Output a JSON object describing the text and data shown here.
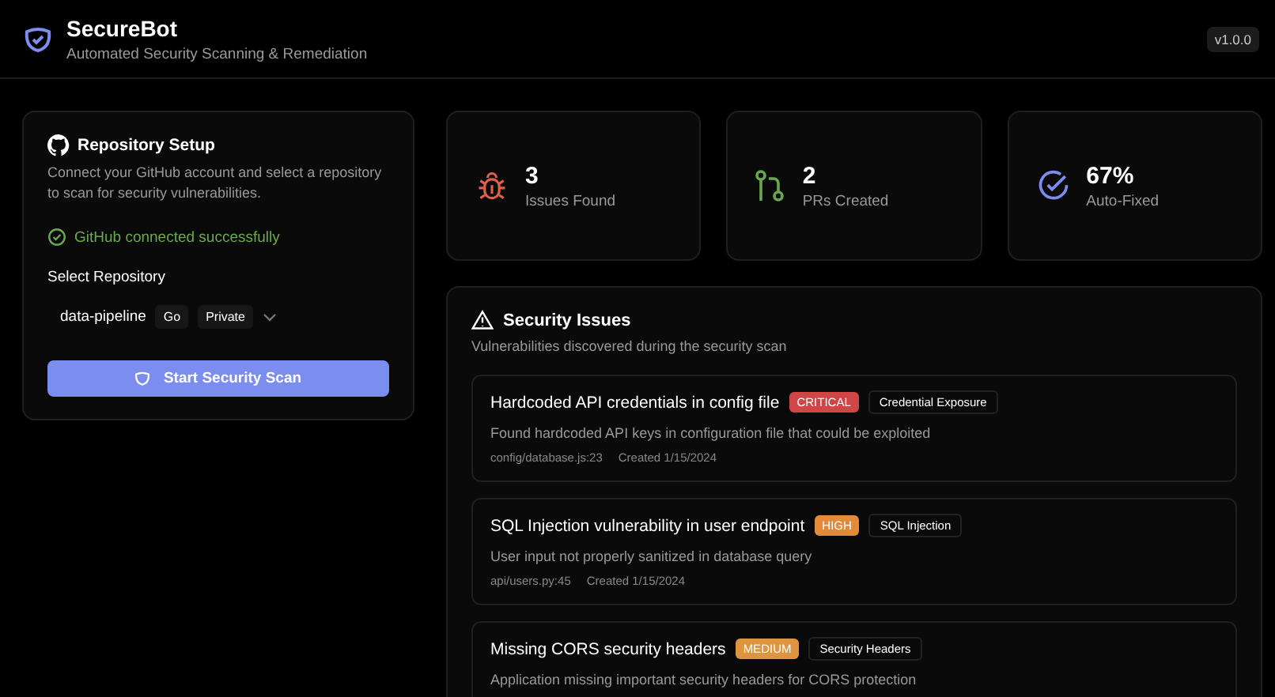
{
  "header": {
    "title": "SecureBot",
    "subtitle": "Automated Security Scanning & Remediation",
    "version": "v1.0.0"
  },
  "setup": {
    "title": "Repository Setup",
    "description": "Connect your GitHub account and select a repository to scan for security vulnerabilities.",
    "status": "GitHub connected successfully",
    "select_label": "Select Repository",
    "repo": {
      "name": "data-pipeline",
      "language": "Go",
      "visibility": "Private"
    },
    "button": "Start Security Scan"
  },
  "stats": [
    {
      "kind": "bug",
      "value": "3",
      "label": "Issues Found"
    },
    {
      "kind": "pr",
      "value": "2",
      "label": "PRs Created"
    },
    {
      "kind": "check",
      "value": "67%",
      "label": "Auto-Fixed"
    }
  ],
  "issues_panel": {
    "title": "Security Issues",
    "subtitle": "Vulnerabilities discovered during the security scan",
    "issues": [
      {
        "title": "Hardcoded API credentials in config file",
        "severity": "CRITICAL",
        "color": "#d04545",
        "category": "Credential Exposure",
        "description": "Found hardcoded API keys in configuration file that could be exploited",
        "location": "config/database.js:23",
        "created": "Created 1/15/2024"
      },
      {
        "title": "SQL Injection vulnerability in user endpoint",
        "severity": "HIGH",
        "color": "#e08a3a",
        "category": "SQL Injection",
        "description": "User input not properly sanitized in database query",
        "location": "api/users.py:45",
        "created": "Created 1/15/2024"
      },
      {
        "title": "Missing CORS security headers",
        "severity": "MEDIUM",
        "color": "#df9540",
        "category": "Security Headers",
        "description": "Application missing important security headers for CORS protection"
      }
    ]
  }
}
